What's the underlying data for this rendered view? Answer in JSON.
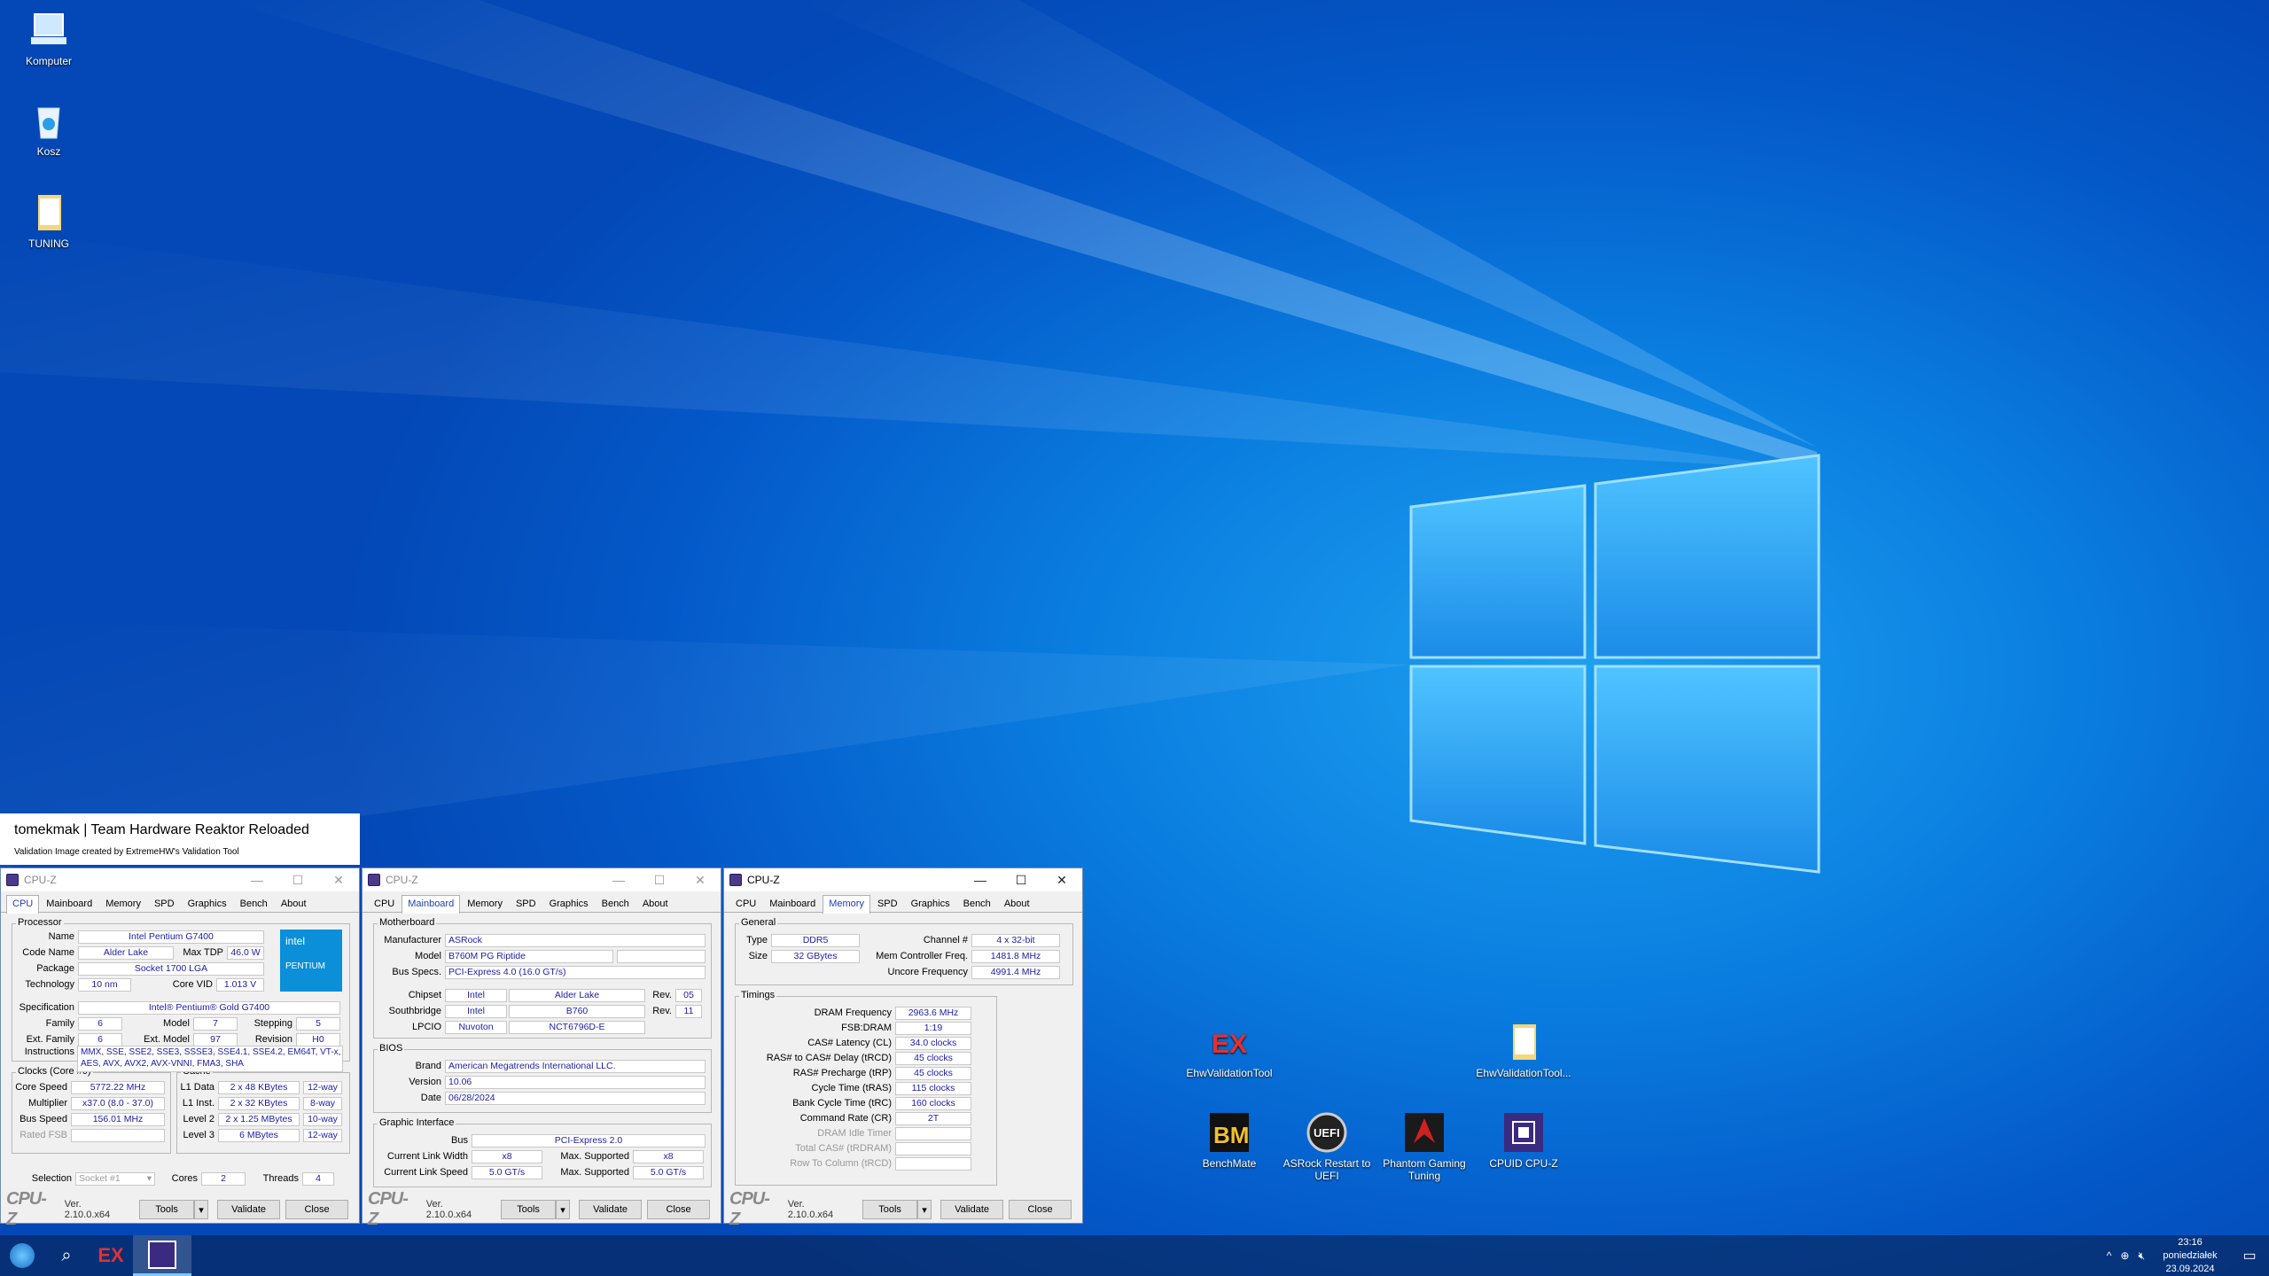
{
  "desktop": {
    "icons": [
      {
        "label": "Komputer",
        "icon": "computer-icon"
      },
      {
        "label": "Kosz",
        "icon": "recycle-bin-icon"
      },
      {
        "label": "TUNING",
        "icon": "folder-icon"
      },
      {
        "label": "EhwValidationTool",
        "icon": "ex-logo-icon"
      },
      {
        "label": "EhwValidationTool...",
        "icon": "folder-icon"
      },
      {
        "label": "BenchMate",
        "icon": "benchmate-icon"
      },
      {
        "label": "ASRock Restart to UEFI",
        "icon": "uefi-icon"
      },
      {
        "label": "Phantom Gaming Tuning",
        "icon": "phantom-gaming-icon"
      },
      {
        "label": "CPUID CPU-Z",
        "icon": "cpuz-icon"
      }
    ]
  },
  "banner": {
    "title": "tomekmak | Team Hardware Reaktor Reloaded",
    "subtitle": "Validation Image created by ExtremeHW's Validation Tool"
  },
  "common": {
    "app": "CPU-Z",
    "version": "Ver. 2.10.0.x64",
    "tools": "Tools",
    "validate": "Validate",
    "close": "Close",
    "tabs": [
      "CPU",
      "Mainboard",
      "Memory",
      "SPD",
      "Graphics",
      "Bench",
      "About"
    ]
  },
  "cpu": {
    "processor_label": "Processor",
    "name_l": "Name",
    "name": "Intel Pentium G7400",
    "codename_l": "Code Name",
    "codename": "Alder Lake",
    "maxtdp_l": "Max TDP",
    "maxtdp": "46.0 W",
    "package_l": "Package",
    "package": "Socket 1700 LGA",
    "tech_l": "Technology",
    "tech": "10 nm",
    "corevid_l": "Core VID",
    "corevid": "1.013 V",
    "spec_l": "Specification",
    "spec": "Intel® Pentium® Gold G7400",
    "family_l": "Family",
    "family": "6",
    "model_l": "Model",
    "model": "7",
    "stepping_l": "Stepping",
    "stepping": "5",
    "extfam_l": "Ext. Family",
    "extfam": "6",
    "extmodel_l": "Ext. Model",
    "extmodel": "97",
    "revision_l": "Revision",
    "revision": "H0",
    "instr_l": "Instructions",
    "instr": "MMX, SSE, SSE2, SSE3, SSSE3, SSE4.1, SSE4.2, EM64T, VT-x, AES, AVX, AVX2, AVX-VNNI, FMA3, SHA",
    "clocks_label": "Clocks (Core #0)",
    "corespeed_l": "Core Speed",
    "corespeed": "5772.22 MHz",
    "mult_l": "Multiplier",
    "mult": "x37.0 (8.0 - 37.0)",
    "bus_l": "Bus Speed",
    "bus": "156.01 MHz",
    "fsb_l": "Rated FSB",
    "cache_label": "Cache",
    "l1d_l": "L1 Data",
    "l1d": "2 x 48 KBytes",
    "l1d_w": "12-way",
    "l1i_l": "L1 Inst.",
    "l1i": "2 x 32 KBytes",
    "l1i_w": "8-way",
    "l2_l": "Level 2",
    "l2": "2 x 1.25 MBytes",
    "l2_w": "10-way",
    "l3_l": "Level 3",
    "l3": "6 MBytes",
    "l3_w": "12-way",
    "sel_l": "Selection",
    "sel": "Socket #1",
    "cores_l": "Cores",
    "cores": "2",
    "threads_l": "Threads",
    "threads": "4",
    "intel_logo": "intel",
    "intel_brand": "PENTIUM"
  },
  "mb": {
    "mb_label": "Motherboard",
    "manu_l": "Manufacturer",
    "manu": "ASRock",
    "model_l": "Model",
    "model": "B760M PG Riptide",
    "busspec_l": "Bus Specs.",
    "busspec": "PCI-Express 4.0 (16.0 GT/s)",
    "chipset_l": "Chipset",
    "chipset_v": "Intel",
    "chipset_n": "Alder Lake",
    "rev_l": "Rev.",
    "chipset_r": "05",
    "south_l": "Southbridge",
    "south_v": "Intel",
    "south_n": "B760",
    "south_r": "11",
    "lpcio_l": "LPCIO",
    "lpcio_v": "Nuvoton",
    "lpcio_n": "NCT6796D-E",
    "bios_label": "BIOS",
    "brand_l": "Brand",
    "brand": "American Megatrends International LLC.",
    "version_l": "Version",
    "version": "10.06",
    "date_l": "Date",
    "date": "06/28/2024",
    "gi_label": "Graphic Interface",
    "gbus_l": "Bus",
    "gbus": "PCI-Express 2.0",
    "clw_l": "Current Link Width",
    "clw": "x8",
    "maxs_l": "Max. Supported",
    "mlw": "x8",
    "cls_l": "Current Link Speed",
    "cls": "5.0 GT/s",
    "mls": "5.0 GT/s"
  },
  "mem": {
    "gen_label": "General",
    "type_l": "Type",
    "type": "DDR5",
    "channel_l": "Channel #",
    "channel": "4 x 32-bit",
    "size_l": "Size",
    "size": "32 GBytes",
    "mcf_l": "Mem Controller Freq.",
    "mcf": "1481.8 MHz",
    "uncore_l": "Uncore Frequency",
    "uncore": "4991.4 MHz",
    "tim_label": "Timings",
    "dram_l": "DRAM Frequency",
    "dram": "2963.6 MHz",
    "fsbdram_l": "FSB:DRAM",
    "fsbdram": "1:19",
    "cl_l": "CAS# Latency (CL)",
    "cl": "34.0 clocks",
    "trcd_l": "RAS# to CAS# Delay (tRCD)",
    "trcd": "45 clocks",
    "trp_l": "RAS# Precharge (tRP)",
    "trp": "45 clocks",
    "tras_l": "Cycle Time (tRAS)",
    "tras": "115 clocks",
    "trc_l": "Bank Cycle Time (tRC)",
    "trc": "160 clocks",
    "cr_l": "Command Rate (CR)",
    "cr": "2T",
    "idle_l": "DRAM Idle Timer",
    "tcas_l": "Total CAS# (tRDRAM)",
    "rtc_l": "Row To Column (tRCD)"
  },
  "taskbar": {
    "time": "23:16",
    "day": "poniedziałek",
    "date": "23.09.2024"
  },
  "colors": {
    "accent": "#0a7ee0",
    "value_text": "#1c1caa"
  }
}
